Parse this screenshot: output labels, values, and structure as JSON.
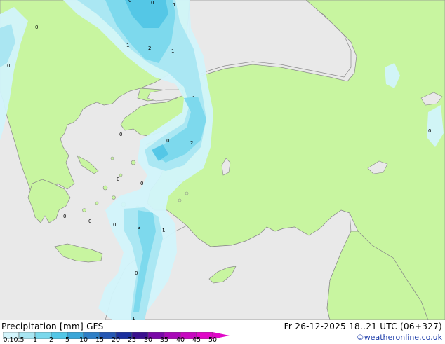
{
  "header": {
    "title": "Precipitation [mm]  GFS",
    "datetime": "Fr 26-12-2025 18..21 UTC (06+327)",
    "credit": "©weatheronline.co.uk"
  },
  "colors": {
    "sea": "#e9e9e9",
    "land": "#c8f5a0",
    "coast": "#8a8a8a",
    "precip_light": "#d2f4fb",
    "precip_mid": "#a8e6f2",
    "precip_strong": "#7ad8ec",
    "precip_heavy": "#52c6e6"
  },
  "legend": {
    "ticks": [
      "0.1",
      "0.5",
      "1",
      "2",
      "5",
      "10",
      "15",
      "20",
      "25",
      "30",
      "35",
      "40",
      "45",
      "50"
    ],
    "colors": [
      "#d2f4fb",
      "#a8e6f2",
      "#7ad8ec",
      "#52c6e6",
      "#3aa6d8",
      "#2e7fc6",
      "#2457b4",
      "#1a2f9e",
      "#3a108e",
      "#7a08a8",
      "#a808b8",
      "#c808c0",
      "#e008c8"
    ]
  },
  "contour_labels": [
    "0",
    "1",
    "0",
    "2",
    "1",
    "1",
    "1",
    "0",
    "0",
    "0",
    "0",
    "0",
    "2",
    "0",
    "1",
    "0",
    "1",
    "0",
    "0",
    "0",
    "3",
    "1",
    "0",
    "1",
    "0",
    "0"
  ]
}
